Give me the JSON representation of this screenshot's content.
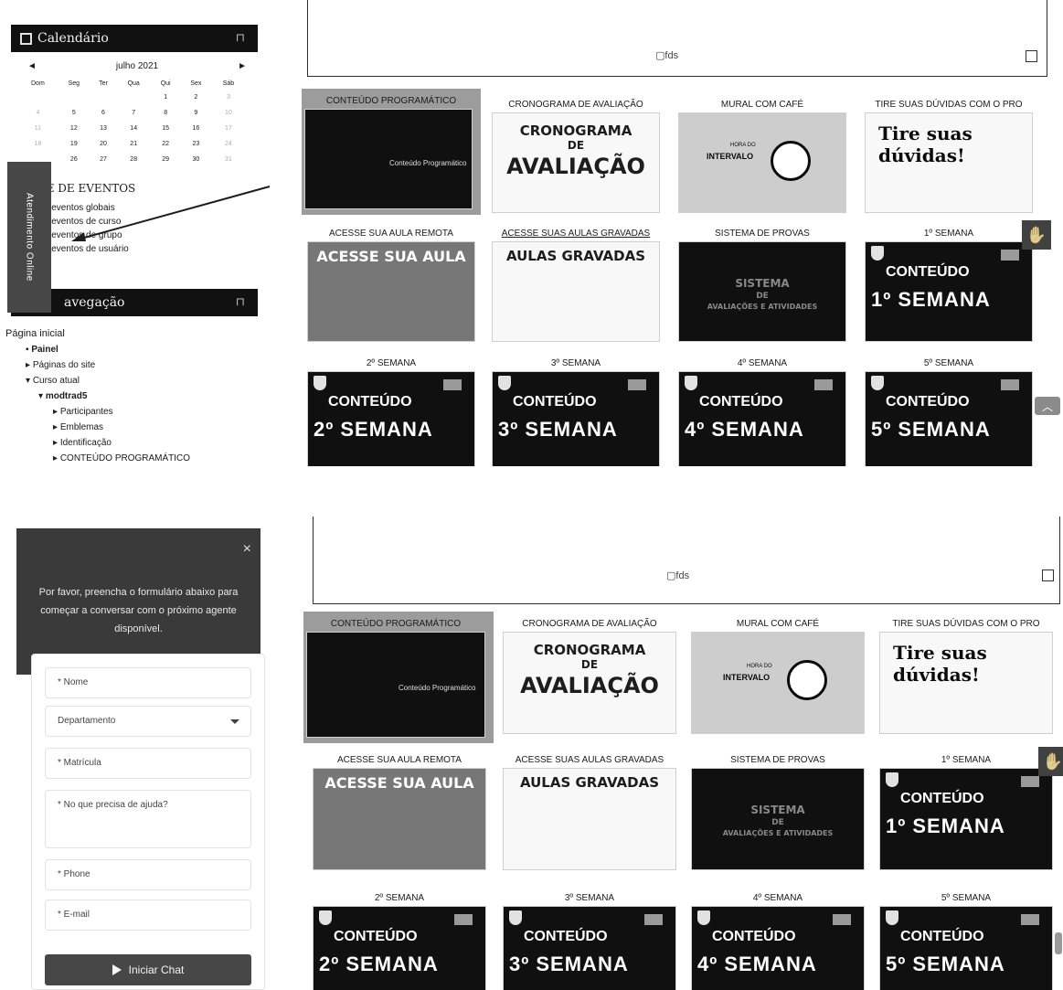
{
  "top": {
    "calendar": {
      "title": "Calendário",
      "month": "julho 2021",
      "prev": "◄",
      "next": "►",
      "days": [
        "Dom",
        "Seg",
        "Ter",
        "Qua",
        "Qui",
        "Sex",
        "Sáb"
      ],
      "weeks": [
        [
          "",
          "",
          "",
          "",
          "1",
          "2",
          "3"
        ],
        [
          "4",
          "5",
          "6",
          "7",
          "8",
          "9",
          "10"
        ],
        [
          "11",
          "12",
          "13",
          "14",
          "15",
          "16",
          "17"
        ],
        [
          "18",
          "19",
          "20",
          "21",
          "22",
          "23",
          "24"
        ],
        [
          "",
          "26",
          "27",
          "28",
          "29",
          "30",
          "31"
        ]
      ]
    },
    "events": {
      "title": "AVE DE EVENTOS",
      "items": [
        "ultar eventos globais",
        "ultar eventos de curso",
        "ultar eventos de grupo",
        "ultar eventos de usuário"
      ]
    },
    "atendimento_tab": "Atendimento Online",
    "navigation": {
      "title": "avegação",
      "home": "Página inicial",
      "items": [
        "Painel",
        "Páginas do site",
        "Curso atual",
        "modtrad5",
        "Participantes",
        "Emblemas",
        "Identificação",
        "CONTEÚDO PROGRAMÁTICO"
      ]
    },
    "banner_alt": "fds",
    "tiles": [
      {
        "label": "CONTEÚDO PROGRAMÁTICO"
      },
      {
        "label": "CRONOGRAMA DE AVALIAÇÃO"
      },
      {
        "label": "MURAL COM CAFÉ"
      },
      {
        "label": "TIRE SUAS DÚVIDAS COM O PRO"
      },
      {
        "label": "ACESSE SUA AULA REMOTA"
      },
      {
        "label": "ACESSE SUAS AULAS GRAVADAS"
      },
      {
        "label": "SISTEMA DE PROVAS"
      },
      {
        "label": "1º SEMANA"
      },
      {
        "label": "2º SEMANA"
      },
      {
        "label": "3º SEMANA"
      },
      {
        "label": "4º SEMANA"
      },
      {
        "label": "5º SEMANA"
      }
    ]
  },
  "bottom": {
    "chat": {
      "message": "Por favor, preencha o formulário abaixo para começar a conversar com o próximo agente disponível.",
      "close": "×",
      "fields": {
        "nome": "* Nome",
        "departamento": "Departamento",
        "matricula": "* Matrícula",
        "ajuda": "* No que precisa de ajuda?",
        "phone": "* Phone",
        "email": "* E-mail"
      },
      "start": "Iniciar Chat"
    },
    "banner_alt": "fds",
    "tiles": [
      {
        "label": "CONTEÚDO PROGRAMÁTICO"
      },
      {
        "label": "CRONOGRAMA DE AVALIAÇÃO"
      },
      {
        "label": "MURAL COM CAFÉ"
      },
      {
        "label": "TIRE SUAS DÚVIDAS COM O PRO"
      },
      {
        "label": "ACESSE SUA AULA REMOTA"
      },
      {
        "label": "ACESSE SUAS AULAS GRAVADAS"
      },
      {
        "label": "SISTEMA DE PROVAS"
      },
      {
        "label": "1º SEMANA"
      },
      {
        "label": "2º SEMANA"
      },
      {
        "label": "3º SEMANA"
      },
      {
        "label": "4º SEMANA"
      },
      {
        "label": "5º SEMANA"
      }
    ]
  },
  "tile_art": {
    "programatico": "Conteúdo Programático",
    "cronograma": [
      "CRONOGRAMA",
      "DE",
      "AVALIAÇÃO"
    ],
    "intervalo": "INTERVALO",
    "hora_do": "HORA DO",
    "tire": [
      "Tire suas",
      "dúvidas!"
    ],
    "acesse": "ACESSE SUA AULA",
    "gravadas": "AULAS GRAVADAS",
    "sistema": [
      "SISTEMA",
      "DE",
      "AVALIAÇÕES E ATIVIDADES"
    ],
    "conteudo": "CONTEÚDO",
    "semanas": [
      "1º SEMANA",
      "2º SEMANA",
      "3º SEMANA",
      "4º SEMANA",
      "5º SEMANA"
    ]
  },
  "icons": [
    "calendar-icon",
    "dock-icon",
    "hand-icon",
    "chevron-up-icon",
    "close-icon",
    "send-icon",
    "checkbox-icon"
  ]
}
